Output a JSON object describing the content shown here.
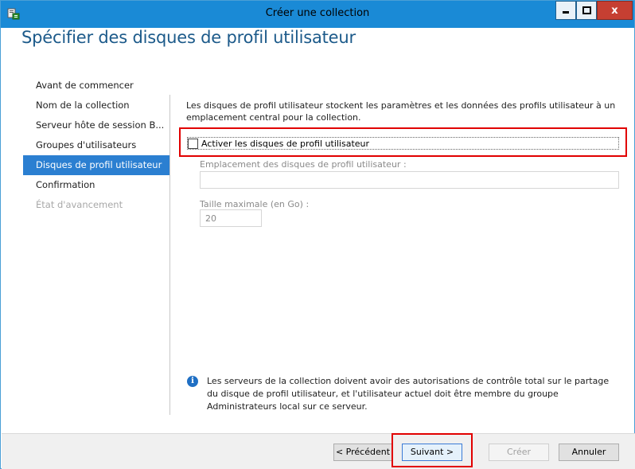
{
  "window": {
    "title": "Créer une collection",
    "close_symbol": "x"
  },
  "page": {
    "title": "Spécifier des disques de profil utilisateur"
  },
  "nav": {
    "items": [
      {
        "label": "Avant de commencer",
        "state": "normal"
      },
      {
        "label": "Nom de la collection",
        "state": "normal"
      },
      {
        "label": "Serveur hôte de session B...",
        "state": "normal"
      },
      {
        "label": "Groupes d'utilisateurs",
        "state": "normal"
      },
      {
        "label": "Disques de profil utilisateur",
        "state": "active"
      },
      {
        "label": "Confirmation",
        "state": "normal"
      },
      {
        "label": "État d'avancement",
        "state": "disabled"
      }
    ]
  },
  "main": {
    "description": "Les disques de profil utilisateur stockent les paramètres et les données des profils utilisateur à un emplacement central pour la collection.",
    "enable_checkbox_label": "Activer les disques de profil utilisateur",
    "location_label": "Emplacement des disques de profil utilisateur :",
    "location_value": "",
    "max_size_label": "Taille maximale (en Go) :",
    "max_size_value": "20",
    "info_text": "Les serveurs de la collection doivent avoir des autorisations de contrôle total sur le partage du disque de profil utilisateur, et l'utilisateur actuel doit être membre du groupe Administrateurs local sur ce serveur."
  },
  "buttons": {
    "previous": "< Précédent",
    "next": "Suivant >",
    "create": "Créer",
    "cancel": "Annuler"
  },
  "colors": {
    "titlebar": "#1a8ad6",
    "page_title": "#1c5a8a",
    "nav_active": "#2b7fd1",
    "highlight": "#e10000"
  }
}
